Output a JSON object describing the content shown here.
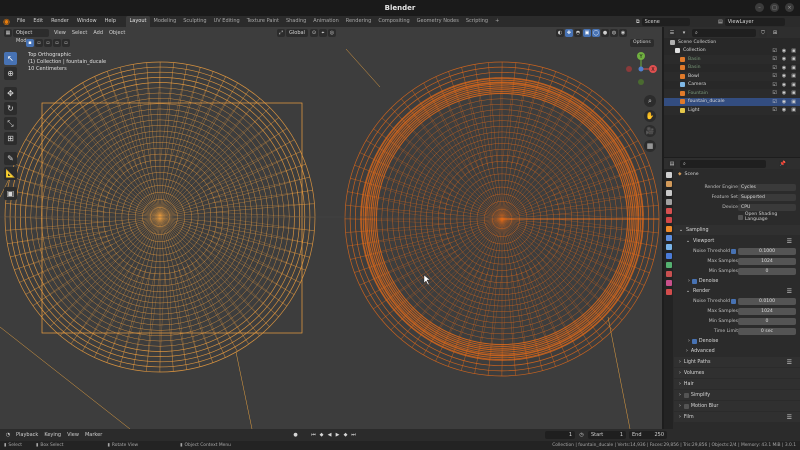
{
  "window": {
    "title": "Blender"
  },
  "menubar": {
    "menus": [
      "File",
      "Edit",
      "Render",
      "Window",
      "Help"
    ],
    "workspaces": [
      "Layout",
      "Modeling",
      "Sculpting",
      "UV Editing",
      "Texture Paint",
      "Shading",
      "Animation",
      "Rendering",
      "Compositing",
      "Geometry Nodes",
      "Scripting"
    ],
    "active_workspace": "Layout",
    "add_tab": "+",
    "scene": "Scene",
    "view_layer": "ViewLayer"
  },
  "viewport": {
    "mode": "Object Mode",
    "menus": [
      "View",
      "Select",
      "Add",
      "Object"
    ],
    "transform_orientation": "Global",
    "options_label": "Options",
    "info_lines": [
      "Top Orthographic",
      "(1) Collection | fountain_ducale",
      "10 Centimeters"
    ],
    "gizmo_axes": {
      "x": "X",
      "y": "Y",
      "z": "Z"
    },
    "colors": {
      "bg": "#3d3d3d",
      "wire_selected": "#f0a040",
      "wire_active": "#e06a1a"
    }
  },
  "outliner": {
    "search_placeholder": "",
    "root": "Scene Collection",
    "items": [
      {
        "label": "Collection",
        "icon_color": "#e0e0e0",
        "indent": 1,
        "selected": false
      },
      {
        "label": "Basin",
        "icon_color": "#e07a2a",
        "indent": 2,
        "selected": false,
        "dim": true
      },
      {
        "label": "Basin",
        "icon_color": "#e07a2a",
        "indent": 2,
        "selected": false,
        "dim": true
      },
      {
        "label": "Bowl",
        "icon_color": "#e07a2a",
        "indent": 2,
        "selected": false,
        "dim": false
      },
      {
        "label": "Camera",
        "icon_color": "#7fb8e6",
        "indent": 2,
        "selected": false,
        "dim": false
      },
      {
        "label": "Fountain",
        "icon_color": "#e07a2a",
        "indent": 2,
        "selected": false,
        "dim": true
      },
      {
        "label": "fountain_ducale",
        "icon_color": "#e07a2a",
        "indent": 2,
        "selected": true,
        "dim": false
      },
      {
        "label": "Light",
        "icon_color": "#e6c84a",
        "indent": 2,
        "selected": false,
        "dim": false
      }
    ]
  },
  "properties": {
    "search_placeholder": "",
    "context": "Scene",
    "render_engine": {
      "label": "Render Engine",
      "value": "Cycles"
    },
    "feature_set": {
      "label": "Feature Set",
      "value": "Supported"
    },
    "device": {
      "label": "Device",
      "value": "CPU"
    },
    "osl": "Open Shading Language",
    "sampling": {
      "title": "Sampling",
      "viewport": {
        "title": "Viewport",
        "noise_threshold": {
          "label": "Noise Threshold",
          "value": "0.1000"
        },
        "max_samples": {
          "label": "Max Samples",
          "value": "1024"
        },
        "min_samples": {
          "label": "Min Samples",
          "value": "0"
        },
        "denoise": "Denoise"
      },
      "render": {
        "title": "Render",
        "noise_threshold": {
          "label": "Noise Threshold",
          "value": "0.0100"
        },
        "max_samples": {
          "label": "Max Samples",
          "value": "1024"
        },
        "min_samples": {
          "label": "Min Samples",
          "value": "0"
        },
        "time_limit": {
          "label": "Time Limit",
          "value": "0 sec"
        },
        "denoise": "Denoise"
      },
      "advanced": "Advanced"
    },
    "panels": [
      "Light Paths",
      "Volumes",
      "Hair",
      "Simplify",
      "Motion Blur",
      "Film"
    ]
  },
  "timeline": {
    "menus": [
      "Playback",
      "Keying",
      "View",
      "Marker"
    ],
    "current_frame": "1",
    "start_label": "Start",
    "start": "1",
    "end_label": "End",
    "end": "250"
  },
  "statusbar": {
    "select": "Select",
    "box_select": "Box Select",
    "rotate_view": "Rotate View",
    "context_menu": "Object Context Menu",
    "stats": "Collection | fountain_ducale | Verts:14,936 | Faces:29,856 | Tris:29,856 | Objects:2/4 | Memory: 43.1 MiB | 3.0.1"
  }
}
